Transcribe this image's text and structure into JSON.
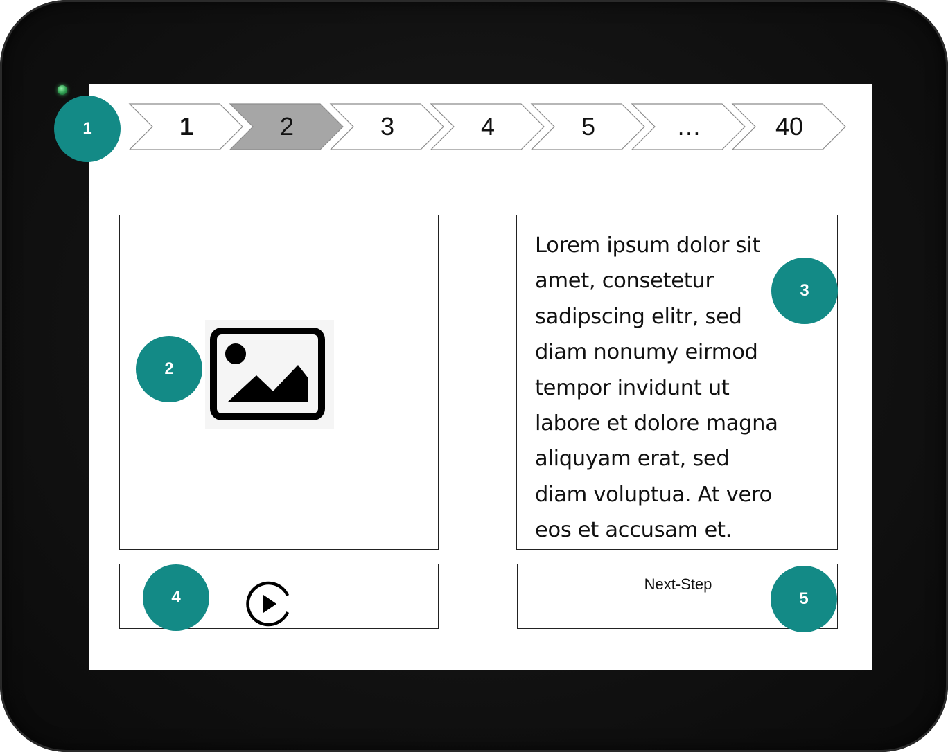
{
  "stepper": {
    "steps": [
      {
        "label": "1",
        "state": "current"
      },
      {
        "label": "2",
        "state": "highlighted"
      },
      {
        "label": "3",
        "state": "default"
      },
      {
        "label": "4",
        "state": "default"
      },
      {
        "label": "5",
        "state": "default"
      },
      {
        "label": "…",
        "state": "default"
      },
      {
        "label": "40",
        "state": "default"
      }
    ],
    "highlight_color": "#a6a6a6"
  },
  "media_panel": {
    "icon": "image-icon"
  },
  "text_panel": {
    "body": "Lorem ipsum dolor sit\namet, consetetur\nsadipscing elitr, sed\ndiam nonumy eirmod\ntempor invidunt ut\nlabore et dolore magna\naliquyam erat, sed\ndiam voluptua. At vero\neos et accusam et."
  },
  "control_panel": {
    "icon": "play-icon"
  },
  "next_panel": {
    "label": "Next-Step"
  },
  "callouts": [
    "1",
    "2",
    "3",
    "4",
    "5"
  ],
  "colors": {
    "callout": "#138a86",
    "bezel": "#121212",
    "led": "#2e9b4f"
  }
}
